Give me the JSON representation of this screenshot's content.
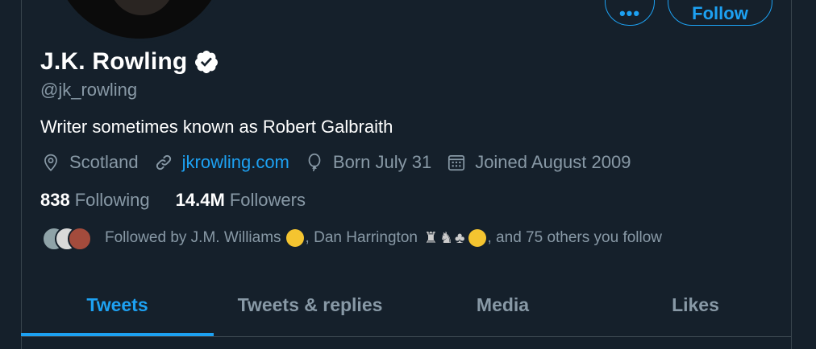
{
  "profile": {
    "name": "J.K. Rowling",
    "handle": "@jk_rowling",
    "bio": "Writer sometimes known as Robert Galbraith",
    "verified": true
  },
  "actions": {
    "more_label": "•••",
    "follow_label": "Follow"
  },
  "meta": {
    "location": "Scotland",
    "website": "jkrowling.com",
    "birthday": "Born July 31",
    "joined": "Joined August 2009"
  },
  "counts": {
    "following_value": "838",
    "following_label": "Following",
    "followers_value": "14.4M",
    "followers_label": "Followers"
  },
  "followed_by": {
    "prefix": "Followed by J.M. Williams",
    "middle": ", Dan Harrington",
    "suffix": ", and 75 others you follow"
  },
  "tabs": [
    {
      "label": "Tweets",
      "active": true
    },
    {
      "label": "Tweets & replies",
      "active": false
    },
    {
      "label": "Media",
      "active": false
    },
    {
      "label": "Likes",
      "active": false
    }
  ],
  "colors": {
    "background": "#15202b",
    "accent": "#1da1f2",
    "secondary_text": "#8899a6",
    "border": "#38444d"
  }
}
